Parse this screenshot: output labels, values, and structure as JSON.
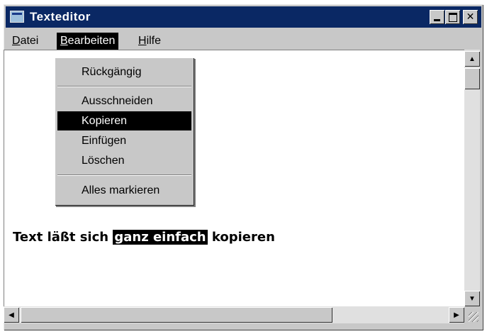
{
  "window": {
    "title": "Texteditor"
  },
  "menubar": {
    "items": [
      {
        "label": "Datei",
        "mnemonic_index": 0
      },
      {
        "label": "Bearbeiten",
        "mnemonic_index": 0,
        "open": true
      },
      {
        "label": "Hilfe",
        "mnemonic_index": 0
      }
    ]
  },
  "dropdown": {
    "items": [
      {
        "label": "Rückgängig"
      },
      {
        "label": "Ausschneiden"
      },
      {
        "label": "Kopieren",
        "highlighted": true
      },
      {
        "label": "Einfügen"
      },
      {
        "label": "Löschen"
      },
      {
        "label": "Alles markieren"
      }
    ]
  },
  "editor": {
    "text_before": "Text läßt sich ",
    "text_selected": "ganz einfach",
    "text_after": " kopieren"
  },
  "icons": {
    "app": "notepad-icon",
    "minimize": "minimize-icon",
    "maximize": "maximize-icon",
    "close": "close-icon",
    "up": "arrow-up-icon",
    "down": "arrow-down-icon",
    "left": "arrow-left-icon",
    "right": "arrow-right-icon"
  },
  "colors": {
    "titlebar": "#0a2864",
    "highlight": "#000000",
    "face": "#c8c8c8"
  }
}
